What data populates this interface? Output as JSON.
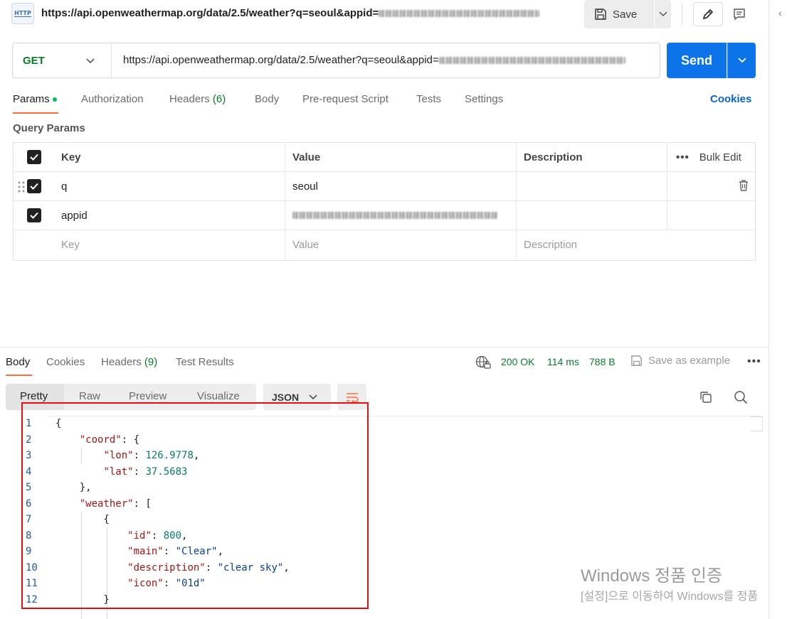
{
  "title_bar": {
    "icon_label": "HTTP",
    "url": "https://api.openweathermap.org/data/2.5/weather?q=seoul&appid=",
    "save_label": "Save"
  },
  "request": {
    "method": "GET",
    "url": "https://api.openweathermap.org/data/2.5/weather?q=seoul&appid=",
    "send_label": "Send"
  },
  "request_tabs": [
    {
      "label": "Params"
    },
    {
      "label": "Authorization"
    },
    {
      "label": "Headers",
      "count": "(6)"
    },
    {
      "label": "Body"
    },
    {
      "label": "Pre-request Script"
    },
    {
      "label": "Tests"
    },
    {
      "label": "Settings"
    }
  ],
  "cookies_label": "Cookies",
  "query_params": {
    "title": "Query Params",
    "headers": {
      "key": "Key",
      "value": "Value",
      "description": "Description",
      "bulk_edit": "Bulk Edit"
    },
    "rows": [
      {
        "key": "q",
        "value": "seoul",
        "checked": true
      },
      {
        "key": "appid",
        "value": "",
        "checked": true
      }
    ],
    "placeholder": {
      "key": "Key",
      "value": "Value",
      "description": "Description"
    }
  },
  "response": {
    "tabs": [
      {
        "label": "Body"
      },
      {
        "label": "Cookies"
      },
      {
        "label": "Headers",
        "count": "(9)"
      },
      {
        "label": "Test Results"
      }
    ],
    "status": "200 OK",
    "time": "114 ms",
    "size": "788 B",
    "save_example": "Save as example",
    "views": [
      "Pretty",
      "Raw",
      "Preview",
      "Visualize"
    ],
    "format": "JSON"
  },
  "code_lines": [
    {
      "num": "1"
    },
    {
      "num": "2",
      "key": "\"coord\"",
      "after": ": {"
    },
    {
      "num": "3",
      "key": "\"lon\"",
      "num_val": "126.9778",
      "after": ","
    },
    {
      "num": "4",
      "key": "\"lat\"",
      "num_val": "37.5683"
    },
    {
      "num": "5"
    },
    {
      "num": "6",
      "key": "\"weather\"",
      "after": ": ["
    },
    {
      "num": "7"
    },
    {
      "num": "8",
      "key": "\"id\"",
      "num_val": "800",
      "after": ","
    },
    {
      "num": "9",
      "key": "\"main\"",
      "str_val": "\"Clear\"",
      "after": ","
    },
    {
      "num": "10",
      "key": "\"description\"",
      "str_val": "\"clear sky\"",
      "after": ","
    },
    {
      "num": "11",
      "key": "\"icon\"",
      "str_val": "\"01d\""
    },
    {
      "num": "12"
    }
  ],
  "watermark": {
    "line1": "Windows 정품 인증",
    "line2": "[설정]으로 이동하여 Windows를 정품"
  },
  "colors": {
    "accent": "#ff6c37",
    "send": "#0c73e8",
    "status_green": "#0a7a2b",
    "highlight": "#e30f13"
  },
  "icons": [
    "http-icon",
    "save-icon",
    "pencil-icon",
    "comment-icon",
    "chevron-down-icon",
    "trash-icon",
    "drag-handle-icon",
    "globe-lock-icon",
    "copy-icon",
    "search-icon",
    "wrap-lines-icon"
  ]
}
